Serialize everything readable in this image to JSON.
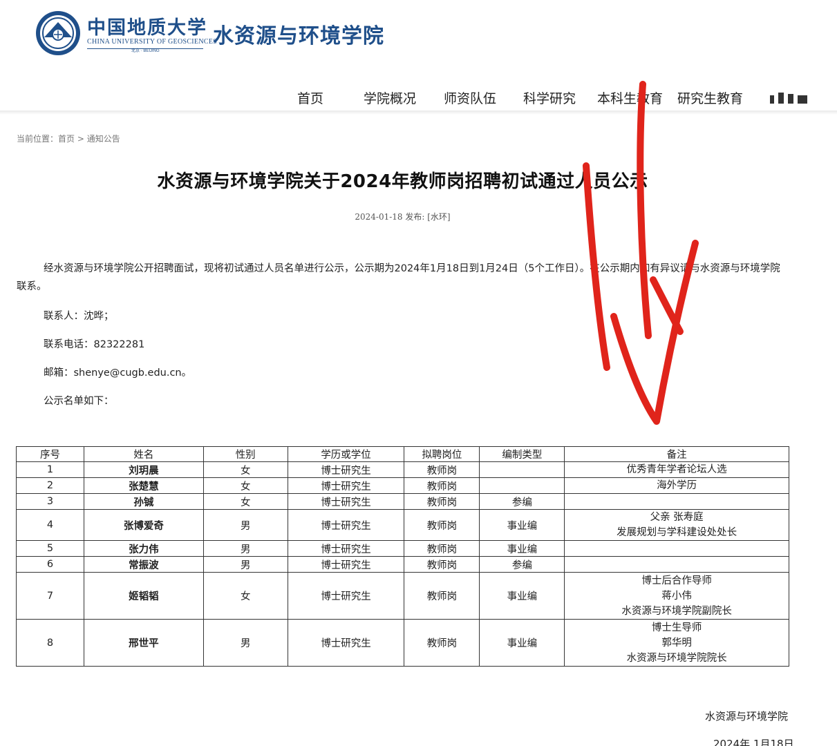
{
  "header": {
    "university_cn": "中国地质大学",
    "university_en": "CHINA UNIVERSITY OF GEOSCIENCES",
    "university_city": "北京 · BEIJING",
    "department": "水资源与环境学院"
  },
  "nav": {
    "items": [
      {
        "label": "首页"
      },
      {
        "label": "学院概况"
      },
      {
        "label": "师资队伍"
      },
      {
        "label": "科学研究"
      },
      {
        "label": "本科生教育"
      },
      {
        "label": "研究生教育"
      }
    ]
  },
  "breadcrumb": {
    "prefix": "当前位置：",
    "home": "首页",
    "sep": " > ",
    "current": "通知公告"
  },
  "article": {
    "title": "水资源与环境学院关于2024年教师岗招聘初试通过人员公示",
    "meta": "2024-01-18 发布: [水环]",
    "intro": "经水资源与环境学院公开招聘面试，现将初试通过人员名单进行公示，公示期为2024年1月18日到1月24日（5个工作日）。在公示期内如有异议请与水资源与环境学院联系。",
    "contact": "联系人：沈晔；",
    "phone": "联系电话：82322281",
    "email": "邮箱：shenye@cugb.edu.cn。",
    "list_intro": "公示名单如下："
  },
  "table": {
    "headers": [
      "序号",
      "姓名",
      "性别",
      "学历或学位",
      "拟聘岗位",
      "编制类型",
      "备注"
    ],
    "rows": [
      {
        "no": "1",
        "name": "刘玥晨",
        "gender": "女",
        "degree": "博士研究生",
        "post": "教师岗",
        "type": "",
        "remarks": [
          "优秀青年学者论坛人选"
        ]
      },
      {
        "no": "2",
        "name": "张楚慧",
        "gender": "女",
        "degree": "博士研究生",
        "post": "教师岗",
        "type": "",
        "remarks": [
          "海外学历"
        ]
      },
      {
        "no": "3",
        "name": "孙铖",
        "gender": "女",
        "degree": "博士研究生",
        "post": "教师岗",
        "type": "参编",
        "remarks": []
      },
      {
        "no": "4",
        "name": "张博爱奇",
        "gender": "男",
        "degree": "博士研究生",
        "post": "教师岗",
        "type": "事业编",
        "remarks": [
          "父亲 张寿庭",
          "发展规划与学科建设处处长"
        ]
      },
      {
        "no": "5",
        "name": "张力伟",
        "gender": "男",
        "degree": "博士研究生",
        "post": "教师岗",
        "type": "事业编",
        "remarks": []
      },
      {
        "no": "6",
        "name": "常振波",
        "gender": "男",
        "degree": "博士研究生",
        "post": "教师岗",
        "type": "参编",
        "remarks": []
      },
      {
        "no": "7",
        "name": "姬韬韬",
        "gender": "女",
        "degree": "博士研究生",
        "post": "教师岗",
        "type": "事业编",
        "remarks": [
          "博士后合作导师",
          "蒋小伟",
          "水资源与环境学院副院长"
        ]
      },
      {
        "no": "8",
        "name": "邢世平",
        "gender": "男",
        "degree": "博士研究生",
        "post": "教师岗",
        "type": "事业编",
        "remarks": [
          "博士生导师",
          "郭华明",
          "水资源与环境学院院长"
        ]
      }
    ]
  },
  "signature": {
    "department": "水资源与环境学院",
    "date": "2024年 1月18日"
  },
  "colors": {
    "brand_blue": "#1f4f8a",
    "annotation_red": "#e0241b"
  }
}
